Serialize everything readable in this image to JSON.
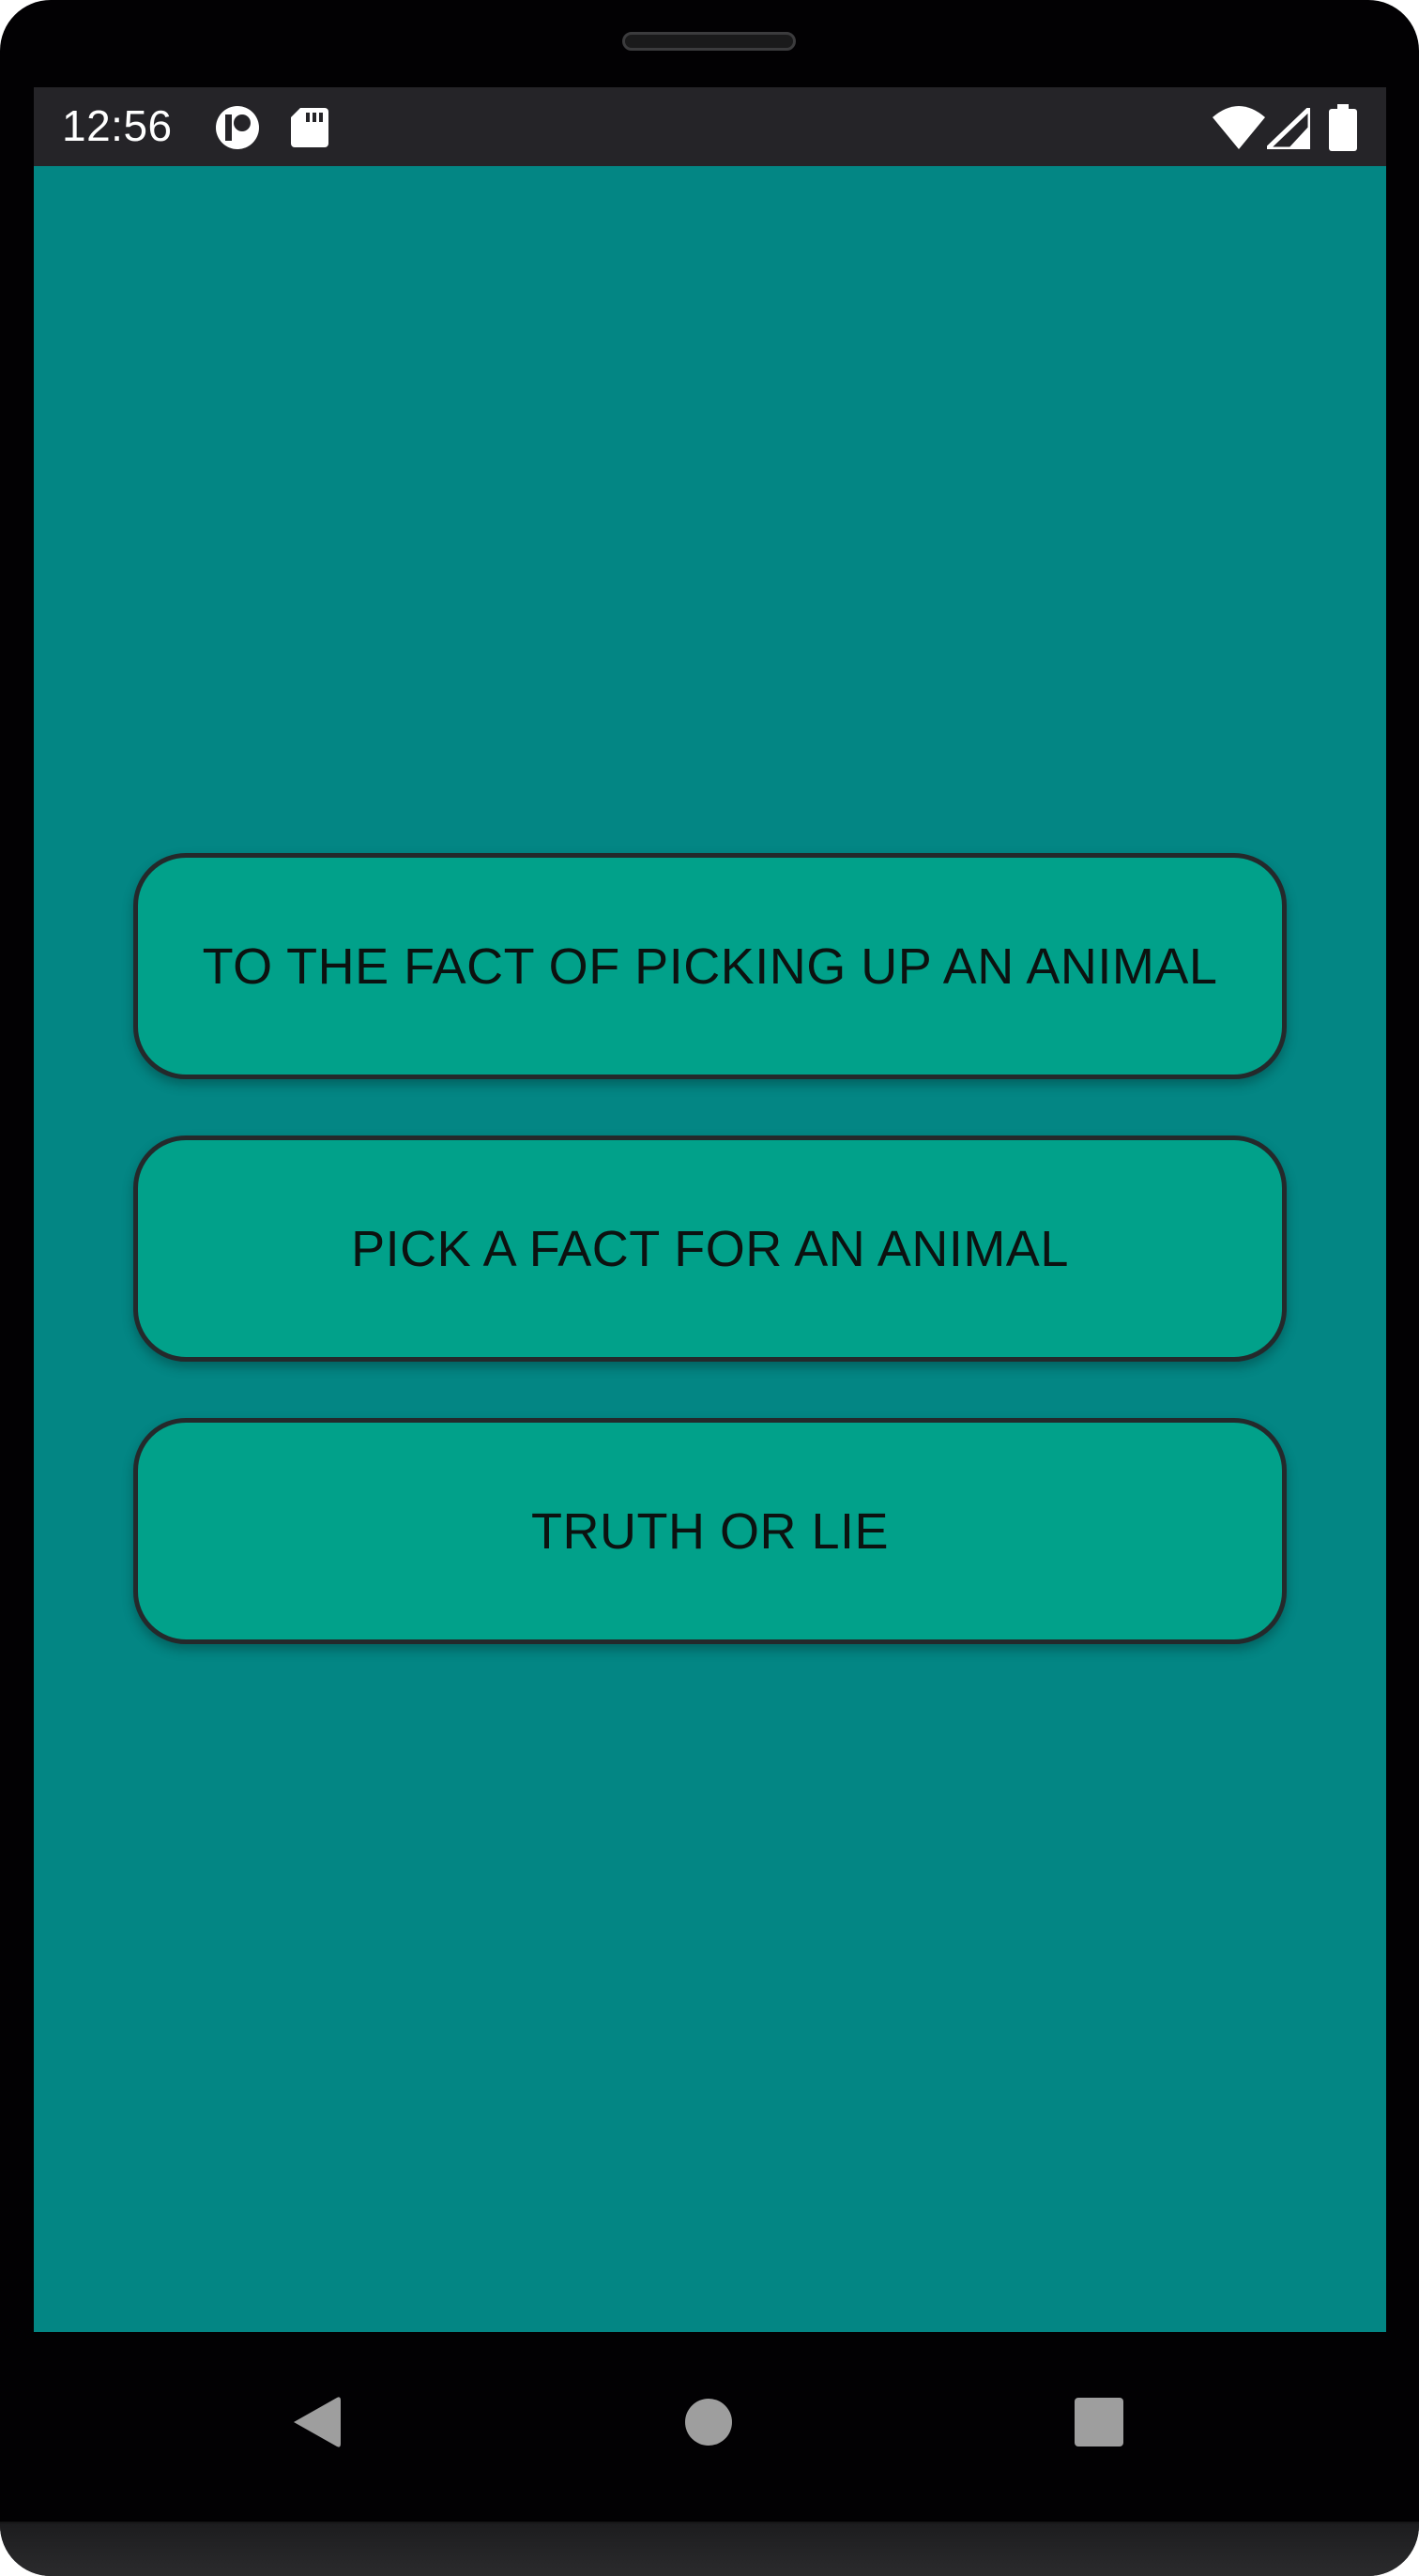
{
  "status_bar": {
    "time": "12:56",
    "left_icons": [
      "app-notification-icon",
      "sd-card-icon"
    ],
    "right_icons": [
      "wifi-icon",
      "cell-signal-icon",
      "battery-icon"
    ]
  },
  "menu": {
    "buttons": [
      {
        "label": "TO THE FACT OF PICKING UP AN ANIMAL"
      },
      {
        "label": "PICK A FACT FOR AN ANIMAL"
      },
      {
        "label": "TRUTH OR LIE"
      }
    ]
  },
  "nav_bar": {
    "icons": [
      "back-icon",
      "home-icon",
      "recents-icon"
    ]
  },
  "colors": {
    "background": "#038684",
    "button_fill": "#01a18a",
    "button_border": "#24292b",
    "status_bar": "#252428",
    "frame": "#020103"
  }
}
